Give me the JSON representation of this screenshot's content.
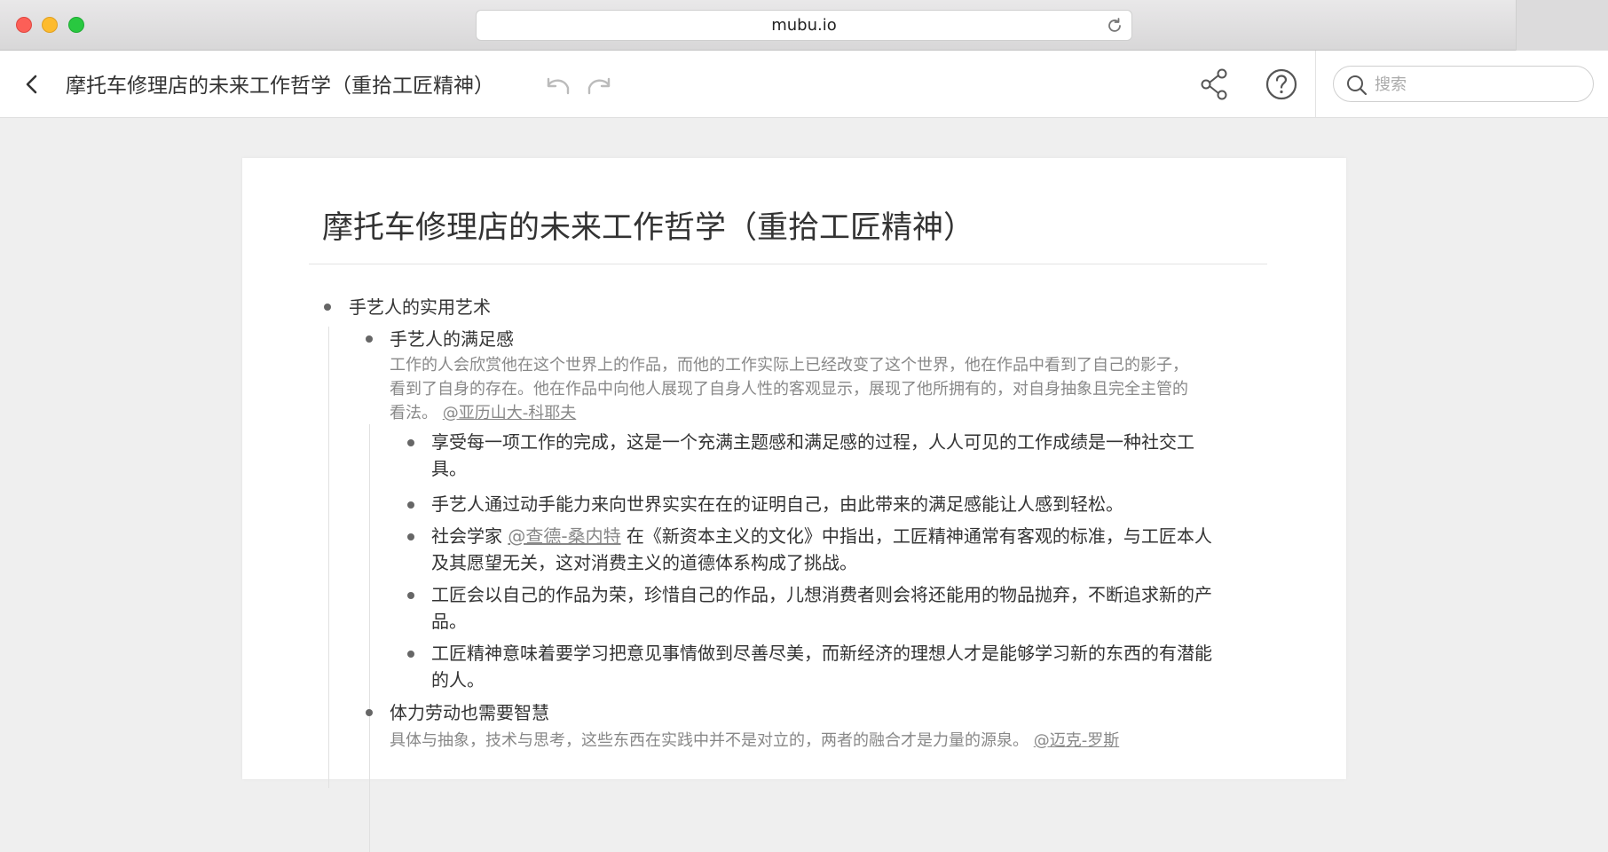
{
  "browser": {
    "url": "mubu.io"
  },
  "toolbar": {
    "title": "摩托车修理店的未来工作哲学（重拾工匠精神）",
    "search_placeholder": "搜索"
  },
  "document": {
    "title": "摩托车修理店的未来工作哲学（重拾工匠精神）",
    "outline": {
      "root": "手艺人的实用艺术",
      "section1": {
        "heading": "手艺人的满足感",
        "note_line1": "工作的人会欣赏他在这个世界上的作品，而他的工作实际上已经改变了这个世界，他在作品中看到了自己的影子，",
        "note_line2": "看到了自身的存在。他在作品中向他人展现了自身人性的客观显示，展现了他所拥有的，对自身抽象且完全主管的",
        "note_line3_prefix": "看法。",
        "note_mention": "@亚历山大-科耶夫",
        "items": [
          {
            "line1": "享受每一项工作的完成，这是一个充满主题感和满足感的过程，人人可见的工作成绩是一种社交工",
            "line2": "具。"
          },
          {
            "line1": "手艺人通过动手能力来向世界实实在在的证明自己，由此带来的满足感能让人感到轻松。"
          },
          {
            "line1_prefix": "社会学家 ",
            "mention": "@查德-桑内特",
            "line1_suffix": " 在《新资本主义的文化》中指出，工匠精神通常有客观的标准，与工匠本人",
            "line2": "及其愿望无关，这对消费主义的道德体系构成了挑战。"
          },
          {
            "line1": "工匠会以自己的作品为荣，珍惜自己的作品，儿想消费者则会将还能用的物品抛弃，不断追求新的产",
            "line2": "品。"
          },
          {
            "line1": "工匠精神意味着要学习把意见事情做到尽善尽美，而新经济的理想人才是能够学习新的东西的有潜能",
            "line2": "的人。"
          }
        ]
      },
      "section2": {
        "heading": "体力劳动也需要智慧",
        "note_prefix": "具体与抽象，技术与思考，这些东西在实践中并不是对立的，两者的融合才是力量的源泉。 ",
        "note_mention": "@迈克-罗斯"
      }
    }
  }
}
